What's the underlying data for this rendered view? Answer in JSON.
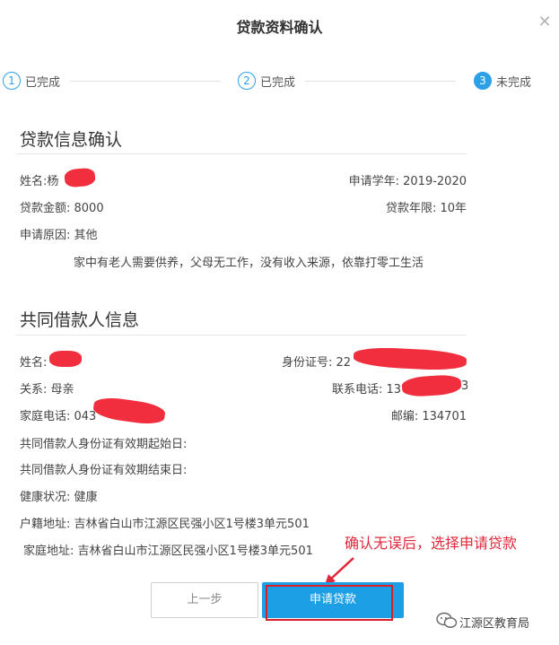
{
  "dialog": {
    "title": "贷款资料确认",
    "close_icon": "close-icon"
  },
  "steps": [
    {
      "number": "1",
      "label": "已完成",
      "state": "done"
    },
    {
      "number": "2",
      "label": "已完成",
      "state": "done"
    },
    {
      "number": "3",
      "label": "未完成",
      "state": "current"
    }
  ],
  "loan_info": {
    "heading": "贷款信息确认",
    "name_label": "姓名:",
    "name_value": "杨",
    "school_year": "申请学年: 2019-2020",
    "amount": "贷款金额: 8000",
    "term": "贷款年限: 10年",
    "reason": "申请原因: 其他",
    "reason_detail": "家中有老人需要供养，父母无工作，没有收入来源，依靠打零工生活"
  },
  "co_borrower": {
    "heading": "共同借款人信息",
    "name": "姓名:",
    "id_number": "身份证号: 22",
    "relation": "关系: 母亲",
    "phone": "联系电话: 13",
    "phone_tail": "3",
    "home_phone": "家庭电话: 043",
    "postcode": "邮编: 134701",
    "id_start": "共同借款人身份证有效期起始日:",
    "id_end": "共同借款人身份证有效期结束日:",
    "health": "健康状况: 健康",
    "household_address": "户籍地址:  吉林省白山市江源区民强小区1号楼3单元501",
    "home_address": "家庭地址:  吉林省白山市江源区民强小区1号楼3单元501"
  },
  "buttons": {
    "prev": "上一步",
    "apply": "申请贷款"
  },
  "annotation": {
    "text": "确认无误后，选择申请贷款",
    "color": "#e0283a"
  },
  "watermark": {
    "text": "江源区教育局",
    "icon": "wechat-icon"
  },
  "colors": {
    "accent": "#1c9fe5",
    "redaction": "#f01e2e"
  }
}
